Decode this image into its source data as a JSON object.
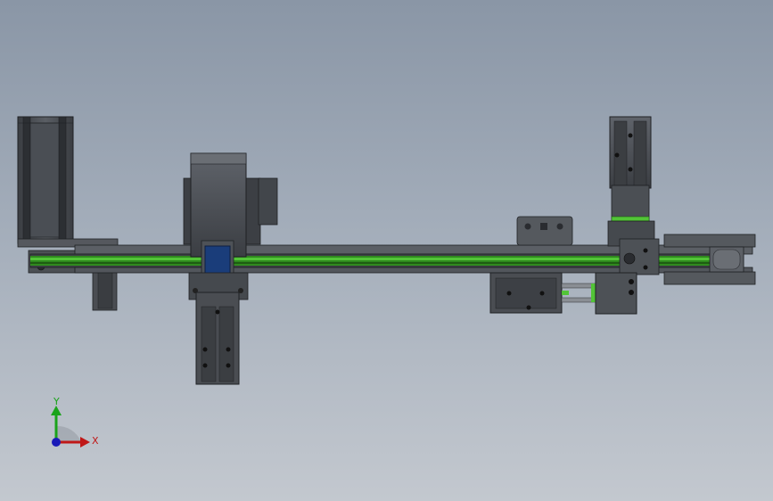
{
  "view": {
    "background_top": "#8a96a6",
    "background_bottom": "#c3c8cf",
    "body_color": "#4a4d52",
    "body_dark": "#2f3236",
    "belt_color": "#2f8a1e",
    "belt_highlight": "#52c437",
    "accent_blue": "#1a3d7a"
  },
  "triad": {
    "y_label": "Y",
    "x_label": "X",
    "y_color": "#1aa31a",
    "x_color": "#c01818",
    "z_color": "#1a1ab8"
  }
}
